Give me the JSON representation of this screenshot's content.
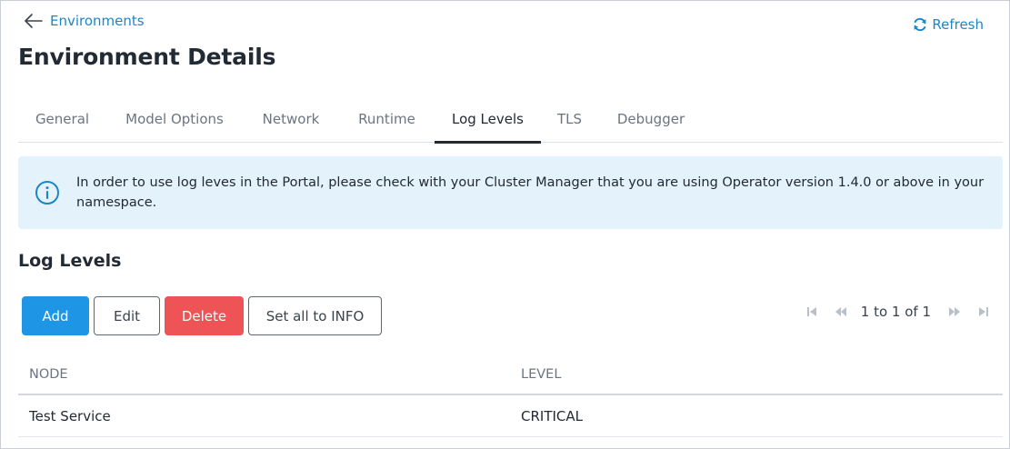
{
  "header": {
    "back_label": "Environments",
    "refresh_label": "Refresh",
    "title": "Environment Details"
  },
  "tabs": [
    {
      "label": "General",
      "active": false
    },
    {
      "label": "Model Options",
      "active": false
    },
    {
      "label": "Network",
      "active": false
    },
    {
      "label": "Runtime",
      "active": false
    },
    {
      "label": "Log Levels",
      "active": true
    },
    {
      "label": "TLS",
      "active": false
    },
    {
      "label": "Debugger",
      "active": false
    }
  ],
  "info_banner": {
    "icon": "info-circle-icon",
    "text": "In order to use log leves in the Portal, please check with your Cluster Manager that you are using Operator version 1.4.0 or above in your namespace."
  },
  "section": {
    "title": "Log Levels"
  },
  "toolbar": {
    "add_label": "Add",
    "edit_label": "Edit",
    "delete_label": "Delete",
    "set_all_label": "Set all to INFO"
  },
  "pagination": {
    "label": "1 to 1 of 1",
    "icons": [
      "first-page-icon",
      "previous-page-icon",
      "next-page-icon",
      "last-page-icon"
    ]
  },
  "table": {
    "columns": [
      "NODE",
      "LEVEL"
    ],
    "rows": [
      {
        "node": "Test Service",
        "level": "CRITICAL"
      }
    ]
  },
  "colors": {
    "accent": "#1d86c9",
    "primary_button": "#1f95e6",
    "danger_button": "#ee5456",
    "banner_bg": "#e4f2fb"
  }
}
